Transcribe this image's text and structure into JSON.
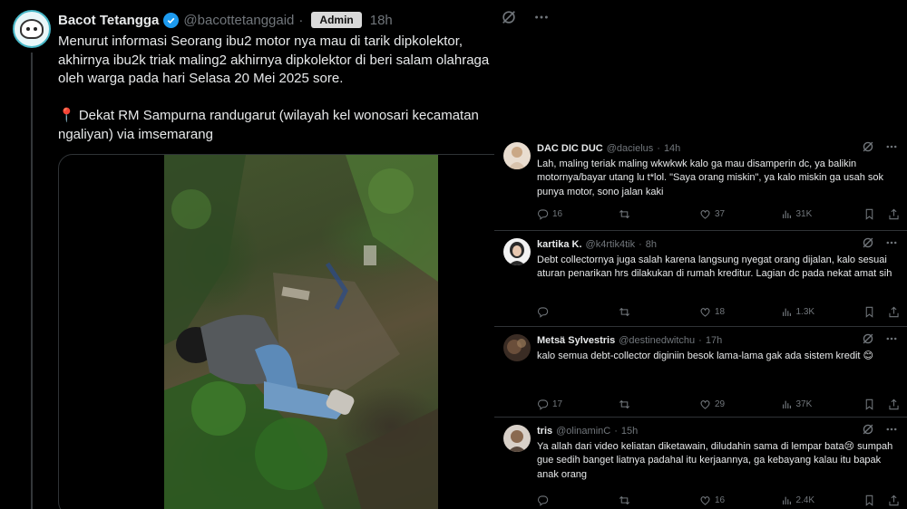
{
  "main_tweet": {
    "name": "Bacot Tetangga",
    "handle": "@bacottetanggaid",
    "dot": "·",
    "badge": "Admin",
    "time": "18h",
    "text": "Menurut informasi Seorang ibu2 motor nya mau di tarik dipkolektor,\nakhirnya ibu2k triak maling2 akhirnya dipkolektor di beri salam olahraga\noleh warga pada hari Selasa 20 Mei 2025 sore.\n\n📍 Dekat RM Sampurna randugarut (wilayah kel wonosari kecamatan\nngaliyan) via imsemarang"
  },
  "replies": [
    {
      "name": "DAC DIC DUC",
      "handle": "@dacielus",
      "time": "14h",
      "text": "Lah, maling teriak maling wkwkwk kalo ga mau disamperin dc, ya balikin motornya/bayar utang lu t*lol. \"Saya orang miskin\", ya kalo miskin ga usah sok punya motor, sono jalan kaki",
      "replies": "16",
      "retweets": "",
      "likes": "37",
      "views": "31K"
    },
    {
      "name": "kartika K.",
      "handle": "@k4rtik4tik",
      "time": "8h",
      "text": "Debt collectornya juga salah karena langsung nyegat orang dijalan, kalo sesuai aturan penarikan hrs dilakukan di rumah kreditur. Lagian dc pada nekat amat sih",
      "replies": "",
      "retweets": "",
      "likes": "18",
      "views": "1.3K"
    },
    {
      "name": "Metsä Sylvestris",
      "handle": "@destinedwitchu",
      "time": "17h",
      "text": "kalo semua debt-collector diginiin besok lama-lama gak ada sistem kredit 😊",
      "replies": "17",
      "retweets": "",
      "likes": "29",
      "views": "37K"
    },
    {
      "name": "tris",
      "handle": "@olinaminC",
      "time": "15h",
      "text": "Ya allah dari video keliatan diketawain, diludahin sama di lempar bata😢 sumpah gue sedih banget liatnya padahal itu kerjaannya, ga kebayang kalau itu bapak anak orang",
      "replies": "",
      "retweets": "",
      "likes": "16",
      "views": "2.4K"
    }
  ],
  "colors": {
    "background": "#000000",
    "text": "#e7e9ea",
    "muted": "#71767b",
    "verified": "#1d9bf0",
    "border": "#2f3336"
  },
  "icons": {
    "grok": "grok-icon",
    "more": "more-icon",
    "reply": "reply-icon",
    "retweet": "retweet-icon",
    "like": "heart-icon",
    "views": "views-icon",
    "bookmark": "bookmark-icon",
    "share": "share-icon"
  }
}
